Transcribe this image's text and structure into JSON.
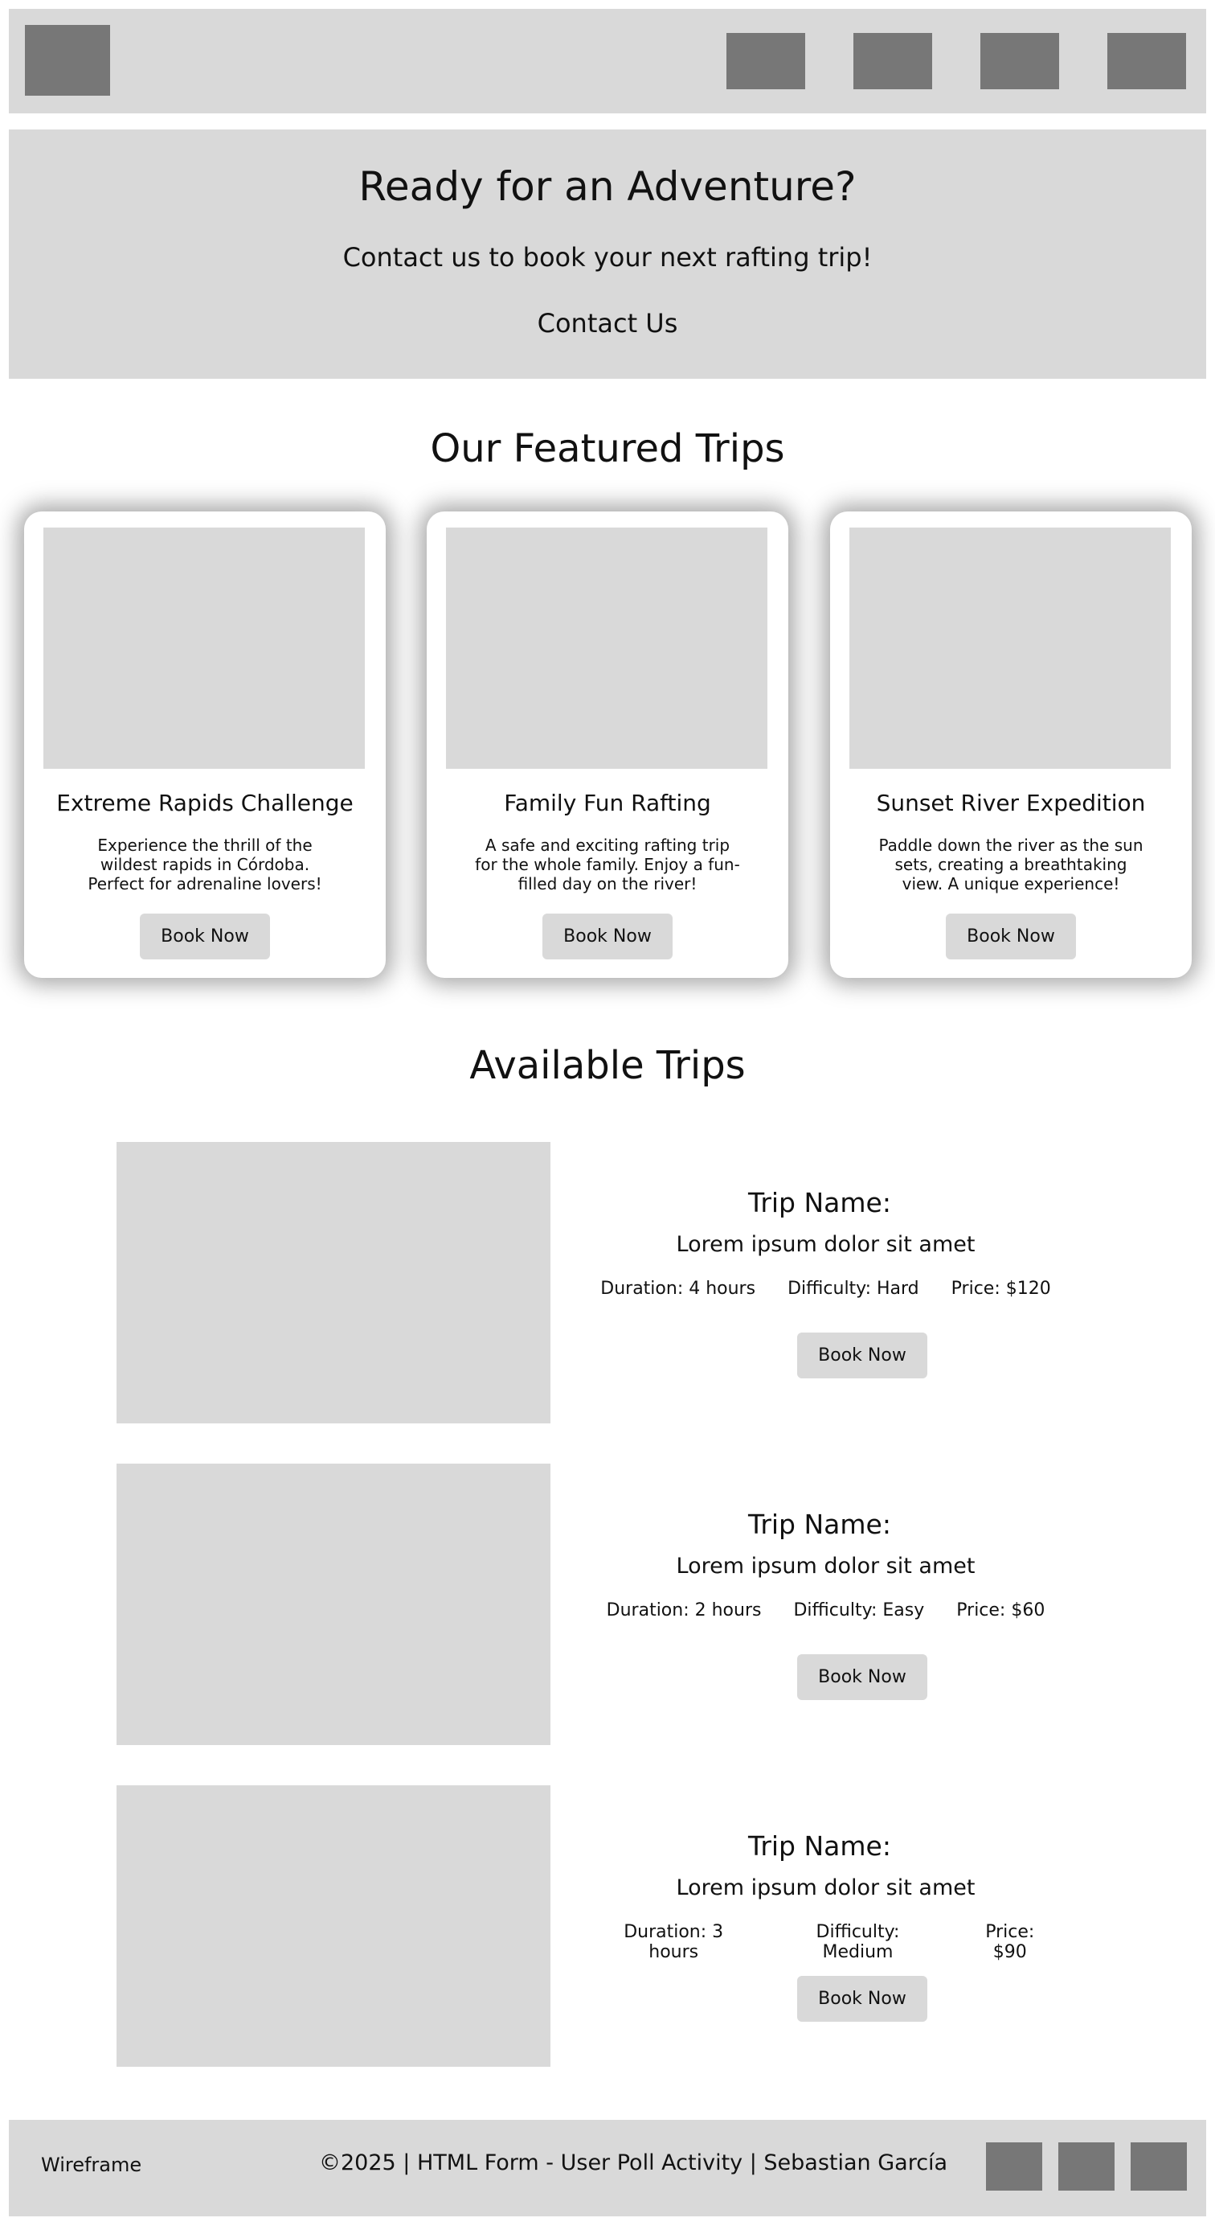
{
  "header": {
    "nav_items": [
      "",
      "",
      "",
      ""
    ]
  },
  "hero": {
    "title": "Ready for an Adventure?",
    "subtitle": "Contact us to book your next rafting trip!",
    "cta_label": "Contact Us"
  },
  "featured": {
    "title": "Our Featured Trips",
    "cards": [
      {
        "title": "Extreme Rapids Challenge",
        "description": "Experience the thrill of the wildest rapids in Córdoba. Perfect for adrenaline lovers!",
        "button_label": "Book Now"
      },
      {
        "title": "Family Fun Rafting",
        "description": "A safe and exciting rafting trip for the whole family. Enjoy a fun-filled day on the river!",
        "button_label": "Book Now"
      },
      {
        "title": "Sunset River Expedition",
        "description": "Paddle down the river as the sun sets, creating a breathtaking view. A unique experience!",
        "button_label": "Book Now"
      }
    ]
  },
  "available": {
    "title": "Available Trips",
    "trips": [
      {
        "name_label": "Trip Name:",
        "description": "Lorem ipsum dolor sit amet",
        "duration": "Duration: 4 hours",
        "difficulty": "Difficulty: Hard",
        "price": "Price: $120",
        "button_label": "Book Now"
      },
      {
        "name_label": "Trip Name:",
        "description": "Lorem ipsum dolor sit amet",
        "duration": "Duration: 2 hours",
        "difficulty": "Difficulty: Easy",
        "price": "Price: $60",
        "button_label": "Book Now"
      },
      {
        "name_label": "Trip Name:",
        "description": "Lorem ipsum dolor sit amet",
        "duration": "Duration: 3 hours",
        "difficulty": "Difficulty: Medium",
        "price": "Price: $90",
        "button_label": "Book Now"
      }
    ]
  },
  "footer": {
    "brand": "Wireframe",
    "copyright": "©2025 | HTML Form - User Poll Activity | Sebastian García"
  },
  "colors": {
    "panel": "#d9d9d9",
    "placeholder_dark": "#777777",
    "text": "#111111"
  }
}
